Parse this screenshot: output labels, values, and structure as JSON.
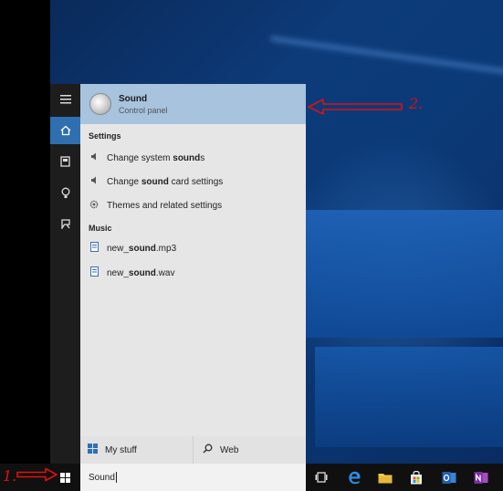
{
  "best_match": {
    "title": "Sound",
    "subtitle": "Control panel",
    "icon": "speaker-disc-icon"
  },
  "sections": {
    "settings": {
      "heading": "Settings",
      "items": [
        {
          "pre": "Change system ",
          "bold": "sound",
          "post": "s",
          "icon": "speaker-icon"
        },
        {
          "pre": "Change ",
          "bold": "sound",
          "post": " card settings",
          "icon": "speaker-icon"
        },
        {
          "pre": "Themes and related settings",
          "bold": "",
          "post": "",
          "icon": "gear-icon"
        }
      ]
    },
    "music": {
      "heading": "Music",
      "items": [
        {
          "pre": "new_",
          "bold": "sound",
          "post": ".mp3",
          "icon": "audio-file-icon"
        },
        {
          "pre": "new_",
          "bold": "sound",
          "post": ".wav",
          "icon": "audio-file-icon"
        }
      ]
    }
  },
  "scope_bar": {
    "my_stuff": "My stuff",
    "web": "Web"
  },
  "search": {
    "value": "Sound"
  },
  "annotations": {
    "one": "1.",
    "two": "2."
  },
  "colors": {
    "accent": "#2f6fb0",
    "highlight": "#a7c3de",
    "arrow": "#dd1111"
  }
}
